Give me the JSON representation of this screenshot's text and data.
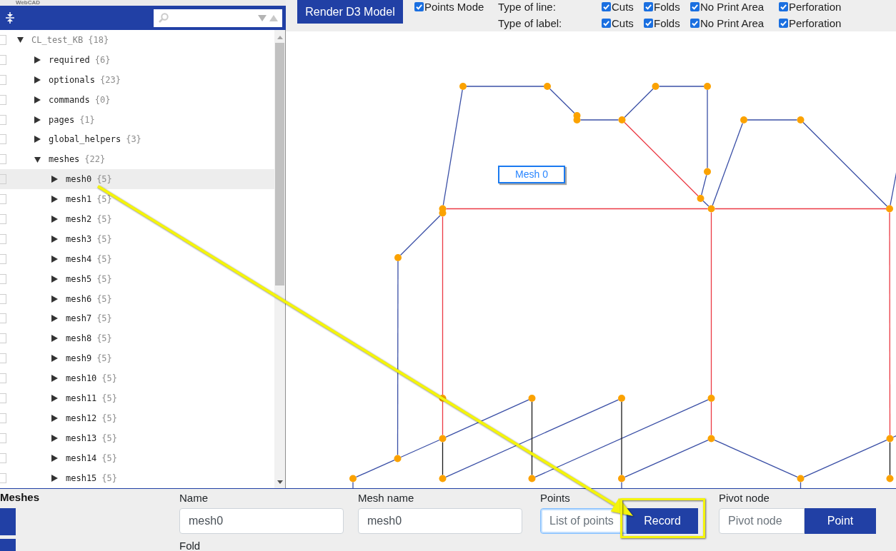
{
  "app": {
    "title": "WebCAD"
  },
  "tree": [
    {
      "label": "CL_test_KB",
      "count": "{18}",
      "checked": false,
      "selected": false,
      "expanded": true,
      "children": [
        {
          "label": "required",
          "count": "{6}",
          "checked": false,
          "selected": false,
          "expanded": false
        },
        {
          "label": "optionals",
          "count": "{23}",
          "checked": false,
          "selected": false,
          "expanded": false
        },
        {
          "label": "commands",
          "count": "{0}",
          "checked": false,
          "selected": false,
          "expanded": false
        },
        {
          "label": "pages",
          "count": "{1}",
          "checked": false,
          "selected": false,
          "expanded": false
        },
        {
          "label": "global_helpers",
          "count": "{3}",
          "checked": false,
          "selected": false,
          "expanded": false
        },
        {
          "label": "meshes",
          "count": "{22}",
          "checked": false,
          "selected": false,
          "expanded": true,
          "children": [
            {
              "label": "mesh0",
              "count": "{5}",
              "checked": false,
              "selected": true,
              "expanded": false
            },
            {
              "label": "mesh1",
              "count": "{5}",
              "checked": false,
              "selected": false,
              "expanded": false
            },
            {
              "label": "mesh2",
              "count": "{5}",
              "checked": false,
              "selected": false,
              "expanded": false
            },
            {
              "label": "mesh3",
              "count": "{5}",
              "checked": false,
              "selected": false,
              "expanded": false
            },
            {
              "label": "mesh4",
              "count": "{5}",
              "checked": false,
              "selected": false,
              "expanded": false
            },
            {
              "label": "mesh5",
              "count": "{5}",
              "checked": false,
              "selected": false,
              "expanded": false
            },
            {
              "label": "mesh6",
              "count": "{5}",
              "checked": false,
              "selected": false,
              "expanded": false
            },
            {
              "label": "mesh7",
              "count": "{5}",
              "checked": false,
              "selected": false,
              "expanded": false
            },
            {
              "label": "mesh8",
              "count": "{5}",
              "checked": false,
              "selected": false,
              "expanded": false
            },
            {
              "label": "mesh9",
              "count": "{5}",
              "checked": false,
              "selected": false,
              "expanded": false
            },
            {
              "label": "mesh10",
              "count": "{5}",
              "checked": false,
              "selected": false,
              "expanded": false
            },
            {
              "label": "mesh11",
              "count": "{5}",
              "checked": false,
              "selected": false,
              "expanded": false
            },
            {
              "label": "mesh12",
              "count": "{5}",
              "checked": false,
              "selected": false,
              "expanded": false
            },
            {
              "label": "mesh13",
              "count": "{5}",
              "checked": false,
              "selected": false,
              "expanded": false
            },
            {
              "label": "mesh14",
              "count": "{5}",
              "checked": false,
              "selected": false,
              "expanded": false
            },
            {
              "label": "mesh15",
              "count": "{5}",
              "checked": false,
              "selected": false,
              "expanded": false
            }
          ]
        }
      ]
    }
  ],
  "toolbar": {
    "render_button": "Render D3 Model",
    "points_mode": {
      "label": "Points Mode",
      "checked": true
    },
    "filters": [
      {
        "label": "Type of line:",
        "options": [
          {
            "label": "Cuts",
            "checked": true
          },
          {
            "label": "Folds",
            "checked": true
          },
          {
            "label": "No Print Area",
            "checked": true
          },
          {
            "label": "Perforation",
            "checked": true
          }
        ]
      },
      {
        "label": "Type of label:",
        "options": [
          {
            "label": "Cuts",
            "checked": true
          },
          {
            "label": "Folds",
            "checked": true
          },
          {
            "label": "No Print Area",
            "checked": true
          },
          {
            "label": "Perforation",
            "checked": true
          }
        ]
      }
    ]
  },
  "canvas": {
    "mesh_label": "Mesh 0"
  },
  "mesh_panel": {
    "title": "Meshes",
    "fields": [
      {
        "label": "Name",
        "value": "mesh0",
        "focused": false
      },
      {
        "label": "Mesh name",
        "value": "mesh0",
        "focused": false
      },
      {
        "label": "Points",
        "placeholder": "List of points",
        "focused": true,
        "button": "Record"
      },
      {
        "label": "Pivot node",
        "placeholder": "Pivot node",
        "focused": false,
        "button": "Point"
      }
    ],
    "fold_label": "Fold"
  }
}
